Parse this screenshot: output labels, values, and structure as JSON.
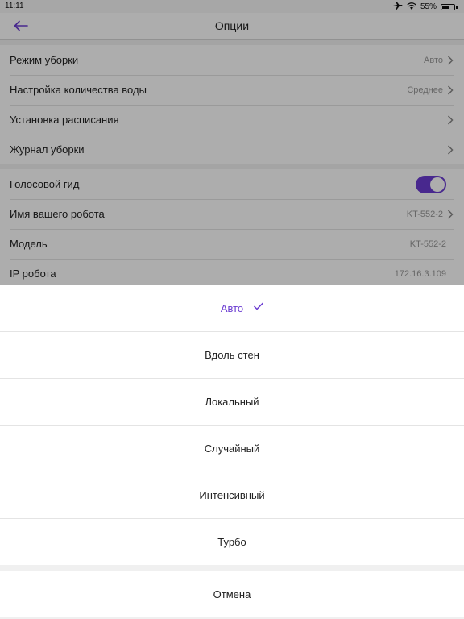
{
  "status_bar": {
    "time": "11:11",
    "battery": "55%",
    "battery_level": 0.55
  },
  "nav": {
    "title": "Опции"
  },
  "settings": {
    "group1": [
      {
        "label": "Режим уборки",
        "value": "Авто"
      },
      {
        "label": "Настройка количества воды",
        "value": "Среднее"
      },
      {
        "label": "Установка расписания",
        "value": ""
      },
      {
        "label": "Журнал уборки",
        "value": ""
      }
    ],
    "group2": {
      "voice": {
        "label": "Голосовой гид",
        "enabled": true
      },
      "robot_name": {
        "label": "Имя вашего робота",
        "value": "KT-552-2"
      },
      "model": {
        "label": "Модель",
        "value": "KT-552-2"
      },
      "ip": {
        "label": "IP робота",
        "value": "172.16.3.109"
      }
    }
  },
  "sheet": {
    "options": [
      "Авто",
      "Вдоль стен",
      "Локальный",
      "Случайный",
      "Интенсивный",
      "Турбо"
    ],
    "selected": "Авто",
    "cancel": "Отмена"
  },
  "colors": {
    "accent": "#6a3bd1"
  }
}
